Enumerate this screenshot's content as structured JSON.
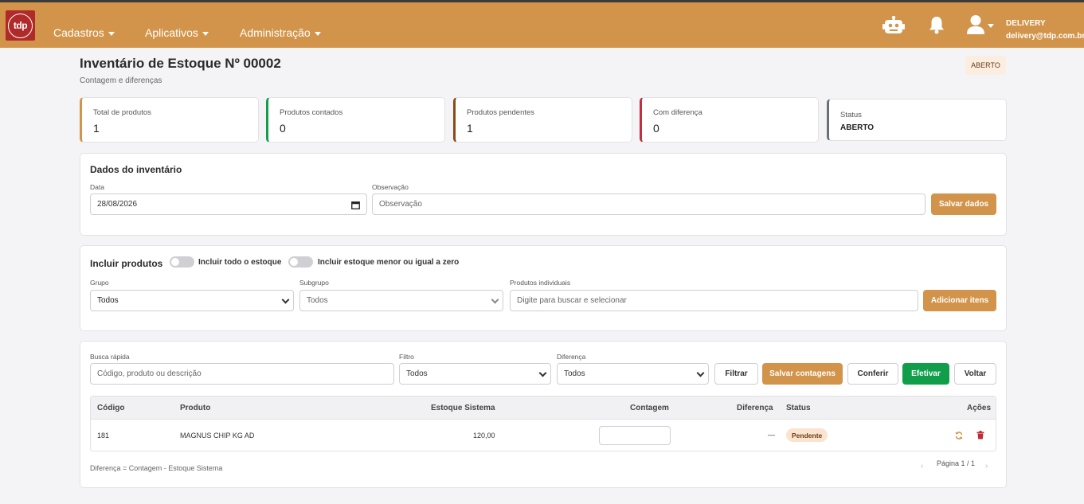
{
  "navbar": {
    "logo_text": "tdp",
    "menus": [
      {
        "label": "Cadastros"
      },
      {
        "label": "Aplicativos"
      },
      {
        "label": "Administração"
      }
    ],
    "icons": [
      "robot-icon",
      "bell-icon",
      "user-icon"
    ],
    "user_name": "DELIVERY",
    "user_email": "delivery@tdp.com.br",
    "color": "#d2944a"
  },
  "header": {
    "title": "Inventário de Estoque Nº 00002",
    "subtitle": "Contagem e diferenças",
    "status_badge": "ABERTO"
  },
  "stats": [
    {
      "label": "Total de produtos",
      "value": "1",
      "accent": "#d2944a"
    },
    {
      "label": "Produtos contados",
      "value": "0",
      "accent": "#119e4b"
    },
    {
      "label": "Produtos pendentes",
      "value": "1",
      "accent": "#8a4a18"
    },
    {
      "label": "Com diferença",
      "value": "0",
      "accent": "#c0313f"
    },
    {
      "label": "Status",
      "value": "ABERTO",
      "accent": "#6b6f7a"
    }
  ],
  "dados": {
    "title": "Dados do inventário",
    "date_label": "Data",
    "date_value": "28/08/2026",
    "obs_label": "Observação",
    "obs_placeholder": "Observação",
    "save_button": "Salvar dados"
  },
  "incluir": {
    "title": "Incluir produtos",
    "toggle_all": "Incluir todo o estoque",
    "toggle_zero": "Incluir estoque menor ou igual a zero",
    "grupo_label": "Grupo",
    "grupo_value": "Todos",
    "subgrupo_label": "Subgrupo",
    "subgrupo_value": "Todos",
    "produtos_label": "Produtos individuais",
    "produtos_placeholder": "Digite para buscar e selecionar",
    "add_button": "Adicionar itens"
  },
  "filters": {
    "busca_label": "Busca rápida",
    "busca_placeholder": "Código, produto ou descrição",
    "filtro_label": "Filtro",
    "filtro_value": "Todos",
    "diferenca_label": "Diferença",
    "diferenca_value": "Todos",
    "filtrar_button": "Filtrar",
    "salvar_button": "Salvar contagens",
    "conferir_button": "Conferir",
    "efetivar_button": "Efetivar",
    "voltar_button": "Voltar"
  },
  "table": {
    "headers": {
      "codigo": "Código",
      "produto": "Produto",
      "estoque": "Estoque Sistema",
      "contagem": "Contagem",
      "diferenca": "Diferença",
      "status": "Status",
      "acoes": "Ações"
    },
    "rows": [
      {
        "codigo": "181",
        "produto": "MAGNUS CHIP KG AD",
        "estoque": "120,00",
        "contagem": "",
        "diferenca": "—",
        "status": "Pendente"
      }
    ]
  },
  "footer": {
    "note": "Diferença = Contagem - Estoque Sistema",
    "pagination": "Página 1 / 1",
    "prev": "‹",
    "next": "›"
  }
}
